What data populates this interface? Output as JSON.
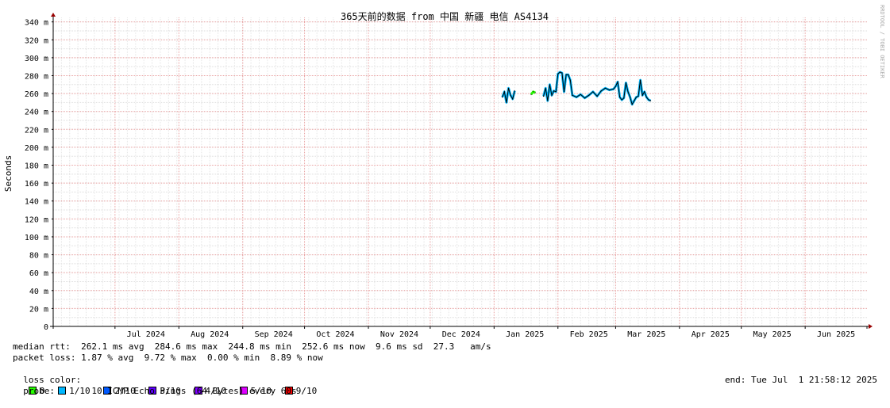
{
  "chart_data": {
    "type": "line",
    "title": "365天前的数据 from 中国 新疆 电信 AS4134",
    "xlabel": "",
    "ylabel": "Seconds",
    "ylim": [
      0,
      0.345
    ],
    "y_ticks": [
      {
        "v": 0,
        "label": "0"
      },
      {
        "v": 0.02,
        "label": "20 m"
      },
      {
        "v": 0.04,
        "label": "40 m"
      },
      {
        "v": 0.06,
        "label": "60 m"
      },
      {
        "v": 0.08,
        "label": "80 m"
      },
      {
        "v": 0.1,
        "label": "100 m"
      },
      {
        "v": 0.12,
        "label": "120 m"
      },
      {
        "v": 0.14,
        "label": "140 m"
      },
      {
        "v": 0.16,
        "label": "160 m"
      },
      {
        "v": 0.18,
        "label": "180 m"
      },
      {
        "v": 0.2,
        "label": "200 m"
      },
      {
        "v": 0.22,
        "label": "220 m"
      },
      {
        "v": 0.24,
        "label": "240 m"
      },
      {
        "v": 0.26,
        "label": "260 m"
      },
      {
        "v": 0.28,
        "label": "280 m"
      },
      {
        "v": 0.3,
        "label": "300 m"
      },
      {
        "v": 0.32,
        "label": "320 m"
      },
      {
        "v": 0.34,
        "label": "340 m"
      }
    ],
    "xlim": [
      "2024-06-01",
      "2025-07-01"
    ],
    "x_months": [
      "2024-06-01",
      "2024-07-01",
      "2024-08-01",
      "2024-09-01",
      "2024-10-01",
      "2024-11-01",
      "2024-12-01",
      "2025-01-01",
      "2025-02-01",
      "2025-03-01",
      "2025-04-01",
      "2025-05-01",
      "2025-06-01",
      "2025-07-01"
    ],
    "x_tick_labels": [
      {
        "date": "2024-07-16",
        "label": "Jul 2024"
      },
      {
        "date": "2024-08-16",
        "label": "Aug 2024"
      },
      {
        "date": "2024-09-16",
        "label": "Sep 2024"
      },
      {
        "date": "2024-10-16",
        "label": "Oct 2024"
      },
      {
        "date": "2024-11-16",
        "label": "Nov 2024"
      },
      {
        "date": "2024-12-16",
        "label": "Dec 2024"
      },
      {
        "date": "2025-01-16",
        "label": "Jan 2025"
      },
      {
        "date": "2025-02-16",
        "label": "Feb 2025"
      },
      {
        "date": "2025-03-16",
        "label": "Mar 2025"
      },
      {
        "date": "2025-04-16",
        "label": "Apr 2025"
      },
      {
        "date": "2025-05-16",
        "label": "May 2025"
      },
      {
        "date": "2025-06-16",
        "label": "Jun 2025"
      }
    ],
    "grid": true,
    "series": [
      {
        "segments": [
          [
            [
              "2025-01-05",
              0.256
            ],
            [
              "2025-01-06",
              0.262
            ],
            [
              "2025-01-07",
              0.25
            ],
            [
              "2025-01-08",
              0.266
            ],
            [
              "2025-01-09",
              0.258
            ],
            [
              "2025-01-10",
              0.254
            ],
            [
              "2025-01-11",
              0.263
            ]
          ],
          [
            [
              "2025-01-19",
              0.259
            ],
            [
              "2025-01-20",
              0.262
            ],
            [
              "2025-01-21",
              0.261
            ]
          ],
          [
            [
              "2025-01-25",
              0.257
            ],
            [
              "2025-01-26",
              0.266
            ],
            [
              "2025-01-27",
              0.252
            ],
            [
              "2025-01-28",
              0.27
            ],
            [
              "2025-01-29",
              0.258
            ],
            [
              "2025-01-30",
              0.263
            ],
            [
              "2025-01-31",
              0.262
            ],
            [
              "2025-02-01",
              0.282
            ],
            [
              "2025-02-02",
              0.284
            ],
            [
              "2025-02-03",
              0.283
            ],
            [
              "2025-02-04",
              0.262
            ],
            [
              "2025-02-05",
              0.281
            ],
            [
              "2025-02-06",
              0.281
            ],
            [
              "2025-02-07",
              0.275
            ],
            [
              "2025-02-08",
              0.258
            ],
            [
              "2025-02-10",
              0.256
            ],
            [
              "2025-02-12",
              0.259
            ],
            [
              "2025-02-14",
              0.255
            ],
            [
              "2025-02-16",
              0.258
            ],
            [
              "2025-02-18",
              0.262
            ],
            [
              "2025-02-20",
              0.257
            ],
            [
              "2025-02-22",
              0.263
            ],
            [
              "2025-02-24",
              0.266
            ],
            [
              "2025-02-26",
              0.264
            ],
            [
              "2025-02-28",
              0.265
            ],
            [
              "2025-03-01",
              0.268
            ],
            [
              "2025-03-02",
              0.273
            ],
            [
              "2025-03-03",
              0.256
            ],
            [
              "2025-03-04",
              0.253
            ],
            [
              "2025-03-05",
              0.255
            ],
            [
              "2025-03-06",
              0.272
            ],
            [
              "2025-03-07",
              0.262
            ],
            [
              "2025-03-08",
              0.256
            ],
            [
              "2025-03-09",
              0.248
            ],
            [
              "2025-03-10",
              0.252
            ],
            [
              "2025-03-11",
              0.256
            ],
            [
              "2025-03-12",
              0.257
            ],
            [
              "2025-03-13",
              0.275
            ],
            [
              "2025-03-14",
              0.258
            ],
            [
              "2025-03-15",
              0.262
            ],
            [
              "2025-03-16",
              0.256
            ],
            [
              "2025-03-17",
              0.253
            ],
            [
              "2025-03-18",
              0.252
            ]
          ]
        ]
      }
    ]
  },
  "side_label": "RRDTOOL / TOBI OETIKER",
  "footer": {
    "median_rtt": "median rtt:  262.1 ms avg  284.6 ms max  244.8 ms min  252.6 ms now  9.6 ms sd  27.3   am/s",
    "packet_loss": "packet loss: 1.87 % avg  9.72 % max  0.00 % min  8.89 % now",
    "loss_color_label": "loss color:",
    "loss_colors": [
      {
        "label": "0",
        "color": "#26ff00"
      },
      {
        "label": "1/10",
        "color": "#00b8ff"
      },
      {
        "label": "2/10",
        "color": "#0059ff"
      },
      {
        "label": "3/10",
        "color": "#5e00ff"
      },
      {
        "label": "4/10",
        "color": "#7e00ff"
      },
      {
        "label": "5/10",
        "color": "#dd00ff"
      },
      {
        "label": "9/10",
        "color": "#ff0000"
      }
    ],
    "probe": "probe:       10 ICMP Echo Pings (64 Bytes) every 60s",
    "end": "end: Tue Jul  1 21:58:12 2025"
  }
}
